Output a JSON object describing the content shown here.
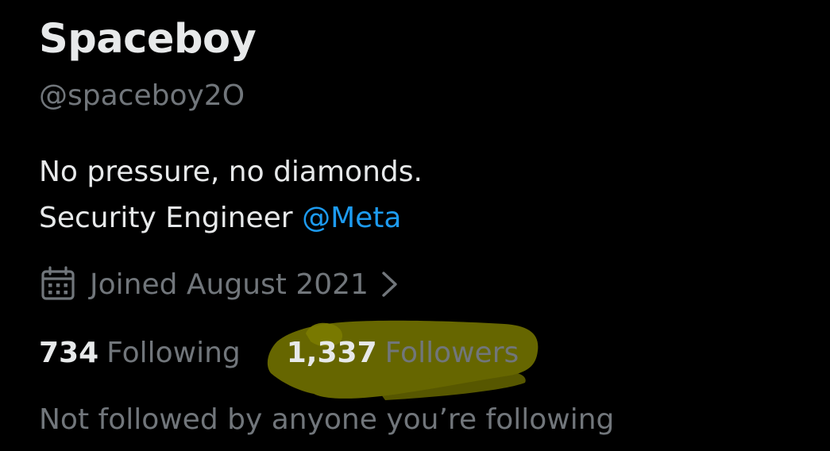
{
  "profile": {
    "display_name": "Spaceboy",
    "handle": "@spaceboy2O",
    "bio_line1": "No pressure, no diamonds.",
    "bio_line2_prefix": "Security Engineer ",
    "bio_mention": "@Meta",
    "joined_text": "Joined August 2021",
    "following_count": "734",
    "following_label": "Following",
    "followers_count": "1,337",
    "followers_label": "Followers",
    "followed_by_text": "Not followed by anyone you’re following"
  },
  "icons": {
    "calendar": "calendar-icon",
    "chevron": "chevron-right-icon"
  },
  "colors": {
    "background": "#000000",
    "primary_text": "#e7e9ea",
    "secondary_text": "#71767b",
    "link": "#1d9bf0",
    "highlighter": "#8a8a00"
  }
}
